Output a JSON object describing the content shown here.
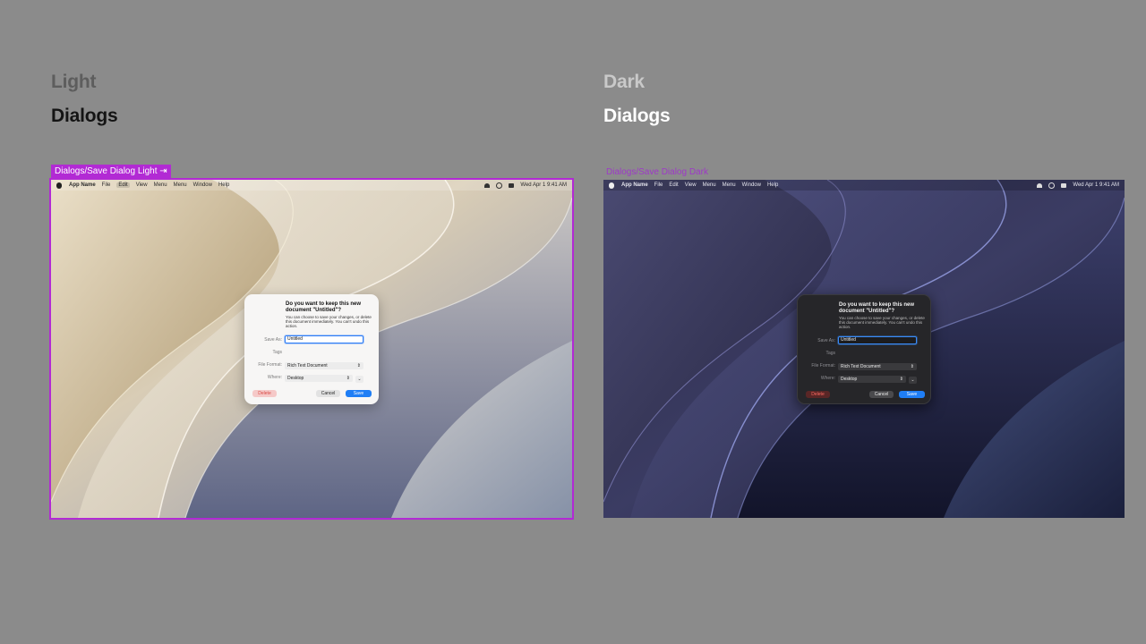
{
  "light": {
    "section_label": "Light",
    "section_title": "Dialogs",
    "frame_tag": "Dialogs/Save Dialog Light ⇥"
  },
  "dark": {
    "section_label": "Dark",
    "section_title": "Dialogs",
    "frame_tag": "Dialogs/Save Dialog Dark"
  },
  "menubar": {
    "app_name": "App Name",
    "items": [
      "File",
      "Edit",
      "View",
      "Menu",
      "Menu",
      "Window",
      "Help"
    ],
    "clock": "Wed Apr 1  9:41 AM"
  },
  "dialog": {
    "title": "Do you want to keep this new document \"Untitled\"?",
    "body": "You can choose to save your changes, or delete this document immediately. You can't undo this action.",
    "save_as_label": "Save As:",
    "save_as_value": "Untitled",
    "tags_label": "Tags",
    "file_format_label": "File Format:",
    "file_format_value": "Rich Text Document",
    "where_label": "Where:",
    "where_value": "Desktop",
    "delete_label": "Delete",
    "cancel_label": "Cancel",
    "save_label": "Save"
  },
  "icons": {
    "apple": "apple-logo-icon",
    "wifi": "wifi-icon",
    "search": "search-icon",
    "control_center": "control-center-icon",
    "select_chevron": "chevron-up-down-icon",
    "expand": "chevron-down-icon"
  },
  "colors": {
    "canvas": "#8b8b8b",
    "selection_accent": "#b22ad4",
    "dark_tag_text": "#9e38c8",
    "save_button": "#1f7ef5"
  }
}
